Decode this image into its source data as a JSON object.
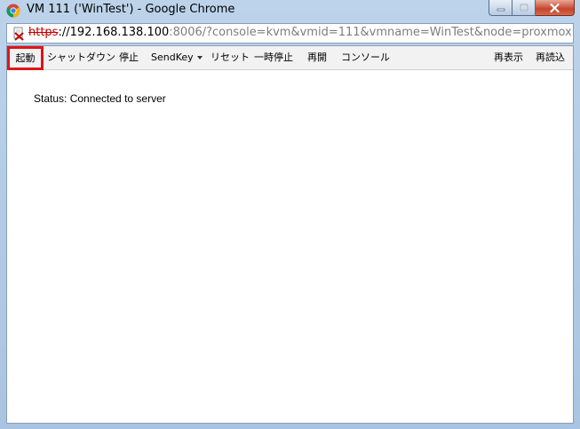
{
  "window": {
    "title": "VM 111 ('WinTest') - Google Chrome"
  },
  "address": {
    "scheme": "https",
    "host": "://192.168.138.100",
    "rest": ":8006/?console=kvm&vmid=111&vmname=WinTest&node=proxmox"
  },
  "toolbar": {
    "start": "起動",
    "shutdown": "シャットダウン",
    "stop": "停止",
    "sendkey": "SendKey",
    "reset": "リセット",
    "suspend": "一時停止",
    "resume": "再開",
    "console": "コンソール",
    "refresh": "再表示",
    "reload": "再読込"
  },
  "status": {
    "text": "Status: Connected to server"
  },
  "colors": {
    "highlight": "#e0141a",
    "insecure_scheme": "#c00000",
    "url_rest": "#7d7d7d"
  }
}
